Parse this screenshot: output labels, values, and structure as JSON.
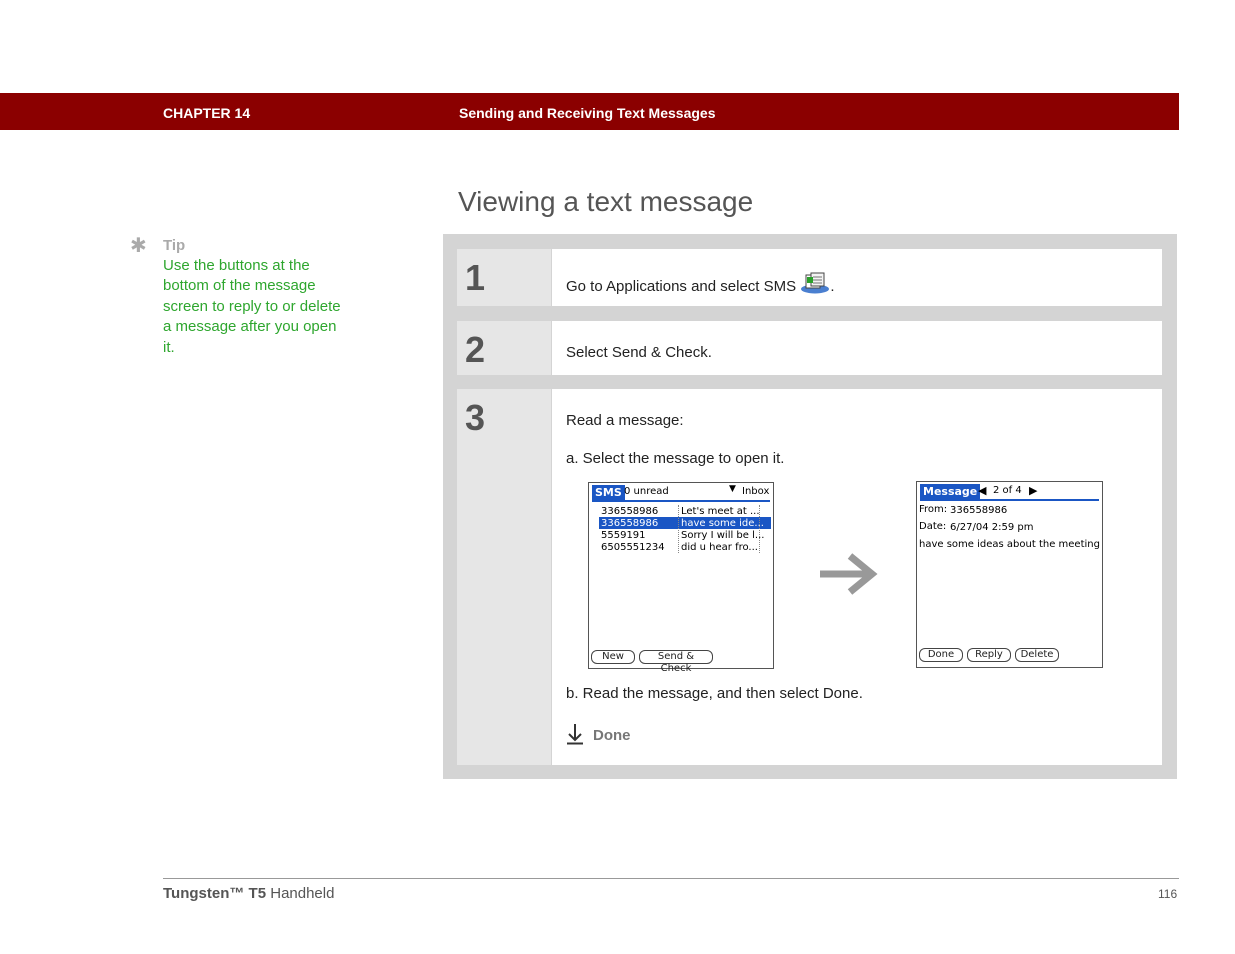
{
  "header": {
    "chapter": "CHAPTER 14",
    "title": "Sending and Receiving Text Messages"
  },
  "page_title": "Viewing a text message",
  "tip": {
    "label": "Tip",
    "text": "Use the buttons at the bottom of the message screen to reply to or delete a message after you open it."
  },
  "steps": [
    {
      "number": "1",
      "text_before": "Go to Applications and select SMS",
      "text_after": "."
    },
    {
      "number": "2",
      "text": "Select Send & Check."
    },
    {
      "number": "3",
      "text": "Read a message:",
      "sub_a": "a.  Select the message to open it.",
      "sub_b": "b.  Read the message, and then select Done."
    }
  ],
  "sms_list_screen": {
    "title": "SMS",
    "unread": "0 unread",
    "folder": "Inbox",
    "rows": [
      {
        "from": "336558986",
        "preview": "Let's meet at ..."
      },
      {
        "from": "336558986",
        "preview": "have some ide..."
      },
      {
        "from": "5559191",
        "preview": "Sorry I will be l..."
      },
      {
        "from": "6505551234",
        "preview": "did u hear fro..."
      }
    ],
    "buttons": {
      "new": "New",
      "send_check": "Send & Check"
    }
  },
  "message_screen": {
    "title": "Message",
    "position": "2 of 4",
    "from_label": "From:",
    "from_value": "336558986",
    "date_label": "Date:",
    "date_value": "6/27/04 2:59 pm",
    "body": "have some ideas about the meeting",
    "buttons": {
      "done": "Done",
      "reply": "Reply",
      "delete": "Delete"
    }
  },
  "done_marker": "Done",
  "footer": {
    "brand_bold": "Tungsten™ T5",
    "brand_rest": " Handheld",
    "page": "116"
  },
  "colors": {
    "header_bar": "#8b0000",
    "tip_text": "#2ea62e",
    "panel": "#d4d4d4",
    "palm_blue": "#1a56c4"
  }
}
